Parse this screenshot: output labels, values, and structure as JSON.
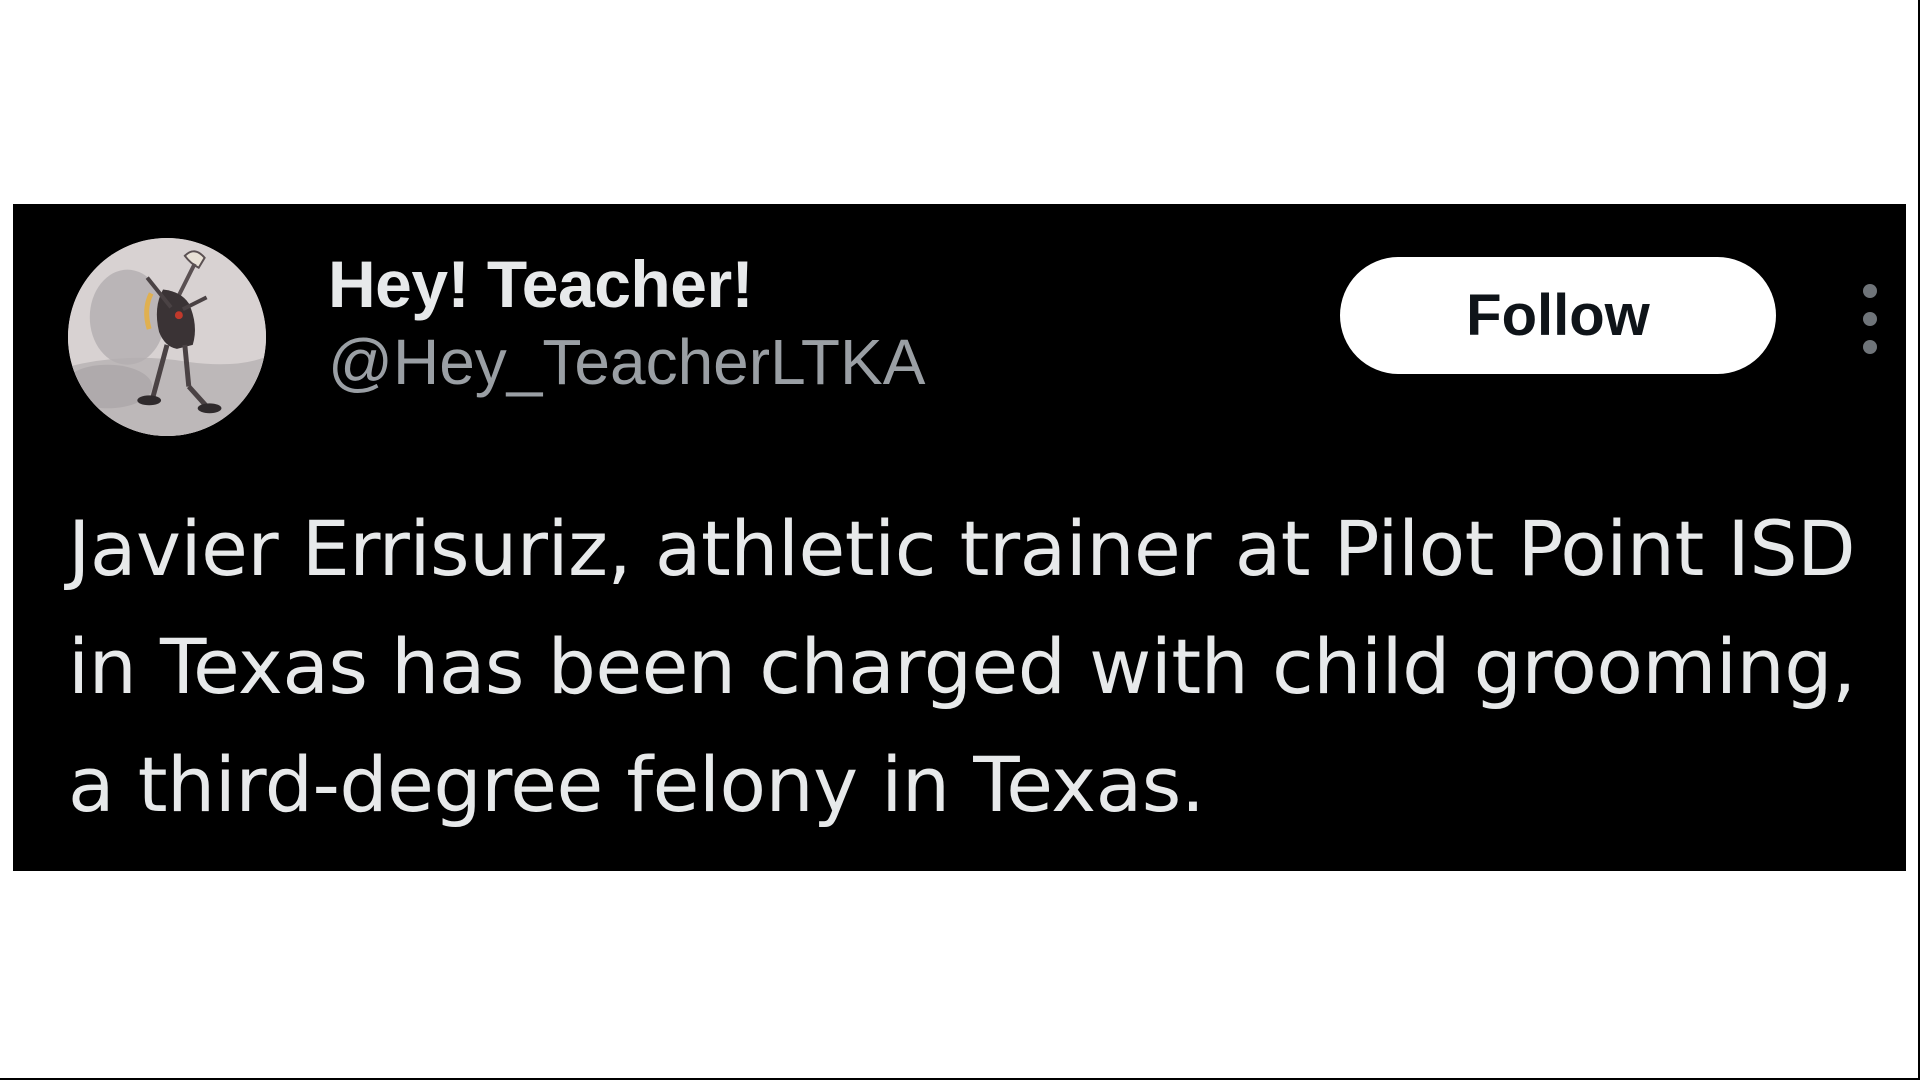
{
  "tweet": {
    "author": {
      "display_name": "Hey! Teacher!",
      "handle": "@Hey_TeacherLTKA",
      "avatar_icon": "cartoon-character-avatar"
    },
    "follow_label": "Follow",
    "more_icon": "vertical-ellipsis-icon",
    "text": "Javier Errisuriz, athletic trainer at Pilot Point ISD in Texas has been charged with child grooming, a third-degree felony in Texas."
  },
  "colors": {
    "card_background": "#000000",
    "page_background": "#ffffff",
    "primary_text": "#e7e9ea",
    "secondary_text": "#9a9fa4",
    "follow_button_background": "#ffffff",
    "follow_button_text": "#0f1419"
  }
}
